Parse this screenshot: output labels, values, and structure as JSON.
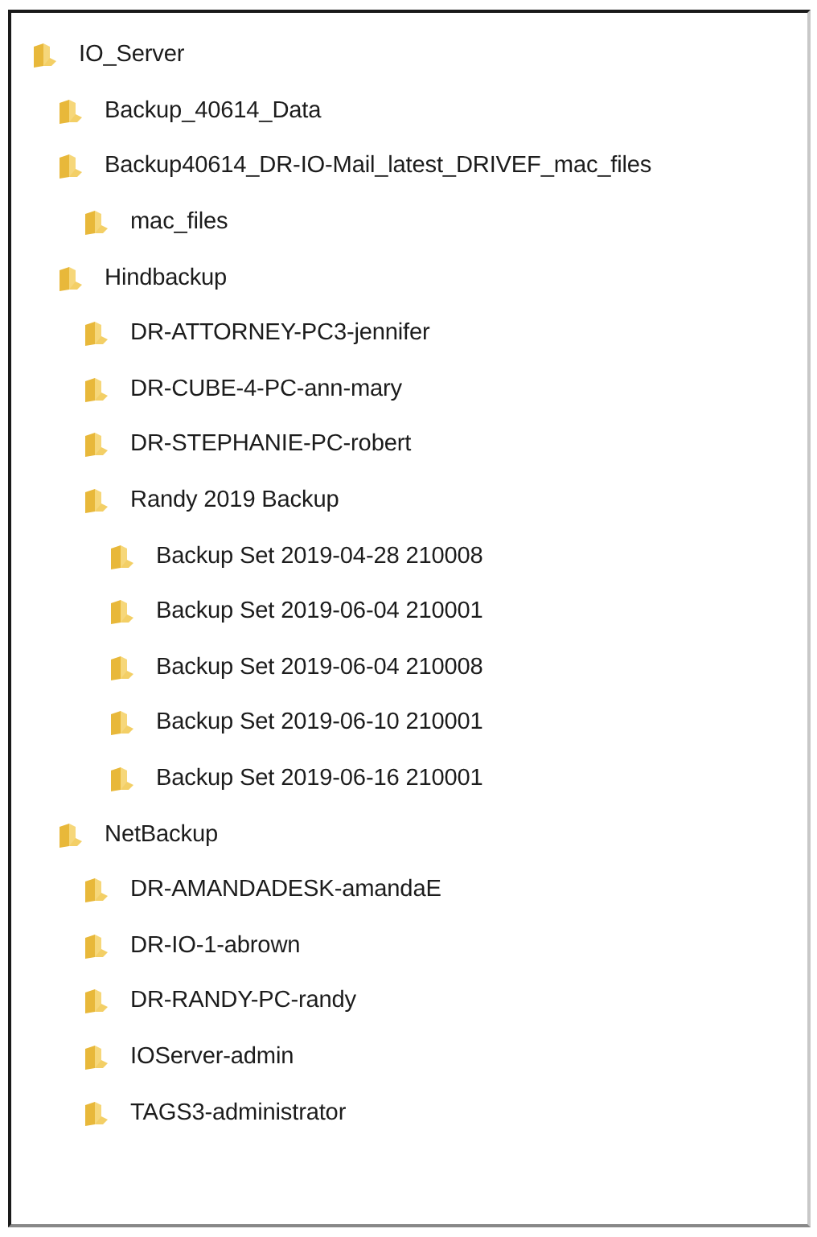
{
  "tree": [
    {
      "label": "IO_Server",
      "children": [
        {
          "label": "Backup_40614_Data"
        },
        {
          "label": "Backup40614_DR-IO-Mail_latest_DRIVEF_mac_files",
          "children": [
            {
              "label": "mac_files"
            }
          ]
        },
        {
          "label": "Hindbackup",
          "children": [
            {
              "label": "DR-ATTORNEY-PC3-jennifer"
            },
            {
              "label": "DR-CUBE-4-PC-ann-mary"
            },
            {
              "label": "DR-STEPHANIE-PC-robert"
            },
            {
              "label": "Randy 2019 Backup",
              "children": [
                {
                  "label": "Backup Set 2019-04-28 210008"
                },
                {
                  "label": "Backup Set 2019-06-04 210001"
                },
                {
                  "label": "Backup Set 2019-06-04 210008"
                },
                {
                  "label": "Backup Set 2019-06-10 210001"
                },
                {
                  "label": "Backup Set 2019-06-16 210001"
                }
              ]
            }
          ]
        },
        {
          "label": "NetBackup",
          "children": [
            {
              "label": "DR-AMANDADESK-amandaE"
            },
            {
              "label": "DR-IO-1-abrown"
            },
            {
              "label": "DR-RANDY-PC-randy"
            },
            {
              "label": "IOServer-admin"
            },
            {
              "label": "TAGS3-administrator"
            }
          ]
        }
      ]
    }
  ]
}
